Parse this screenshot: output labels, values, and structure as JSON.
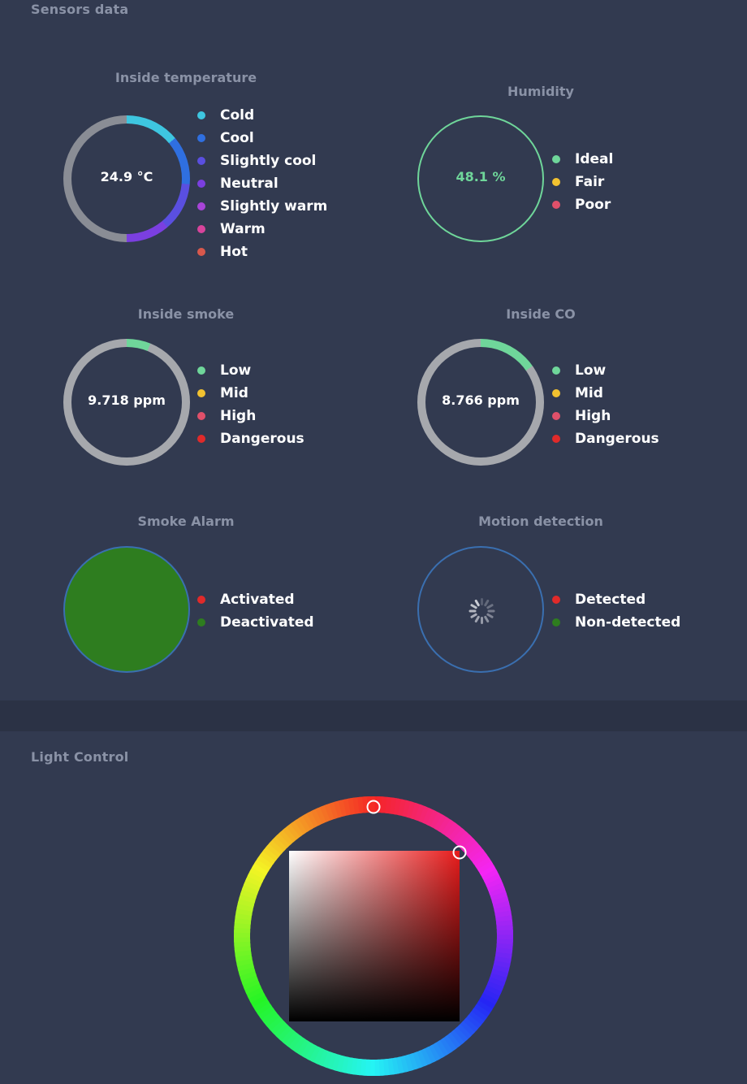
{
  "sensors_panel": {
    "title": "Sensors data",
    "temperature": {
      "title": "Inside temperature",
      "value": "24.9 °C",
      "legend": [
        {
          "label": "Cold",
          "color": "#3ec6e0"
        },
        {
          "label": "Cool",
          "color": "#2f6fe0"
        },
        {
          "label": "Slightly cool",
          "color": "#5a4fe0"
        },
        {
          "label": "Neutral",
          "color": "#7b3fe0"
        },
        {
          "label": "Slightly warm",
          "color": "#a844d8"
        },
        {
          "label": "Warm",
          "color": "#d8449c"
        },
        {
          "label": "Hot",
          "color": "#d8584c"
        }
      ]
    },
    "humidity": {
      "title": "Humidity",
      "value": "48.1 %",
      "value_color": "#6fd69a",
      "legend": [
        {
          "label": "Ideal",
          "color": "#6fd69a"
        },
        {
          "label": "Fair",
          "color": "#f2c230"
        },
        {
          "label": "Poor",
          "color": "#e0506a"
        }
      ]
    },
    "smoke": {
      "title": "Inside smoke",
      "value": "9.718 ppm",
      "legend": [
        {
          "label": "Low",
          "color": "#6fd69a"
        },
        {
          "label": "Mid",
          "color": "#f2c230"
        },
        {
          "label": "High",
          "color": "#e0506a"
        },
        {
          "label": "Dangerous",
          "color": "#e02a2a"
        }
      ]
    },
    "co": {
      "title": "Inside CO",
      "value": "8.766 ppm",
      "legend": [
        {
          "label": "Low",
          "color": "#6fd69a"
        },
        {
          "label": "Mid",
          "color": "#f2c230"
        },
        {
          "label": "High",
          "color": "#e0506a"
        },
        {
          "label": "Dangerous",
          "color": "#e02a2a"
        }
      ]
    },
    "smoke_alarm": {
      "title": "Smoke Alarm",
      "state_color": "#2e7d1f",
      "legend": [
        {
          "label": "Activated",
          "color": "#e02a2a"
        },
        {
          "label": "Deactivated",
          "color": "#2e7d1f"
        }
      ]
    },
    "motion": {
      "title": "Motion detection",
      "legend": [
        {
          "label": "Detected",
          "color": "#e02a2a"
        },
        {
          "label": "Non-detected",
          "color": "#2e7d1f"
        }
      ]
    }
  },
  "light_panel": {
    "title": "Light Control",
    "selected_hue_color": "#e81c1c"
  }
}
